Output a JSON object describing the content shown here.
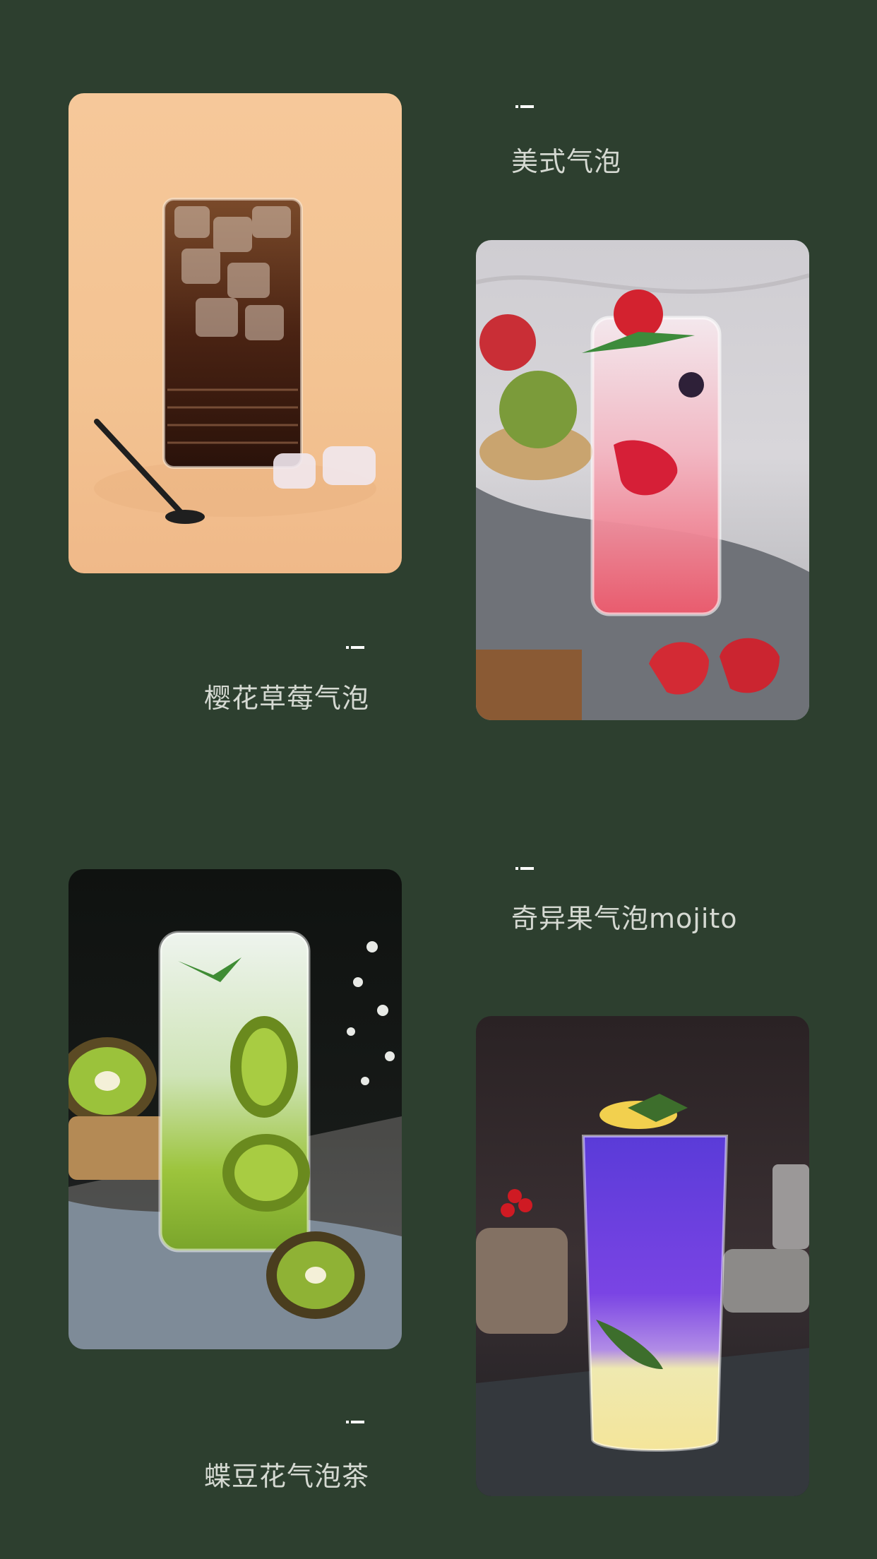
{
  "drinks": [
    {
      "name": "美式气泡",
      "image": "cola-glass-with-ice"
    },
    {
      "name": "樱花草莓气泡",
      "image": "strawberry-soda"
    },
    {
      "name": "奇异果气泡mojito",
      "image": "kiwi-mojito"
    },
    {
      "name": "蝶豆花气泡茶",
      "image": "butterfly-pea-tea"
    }
  ],
  "colors": {
    "background": "#2d3f2f",
    "label_text": "#d5d9d2",
    "dash": "#ffffff"
  }
}
